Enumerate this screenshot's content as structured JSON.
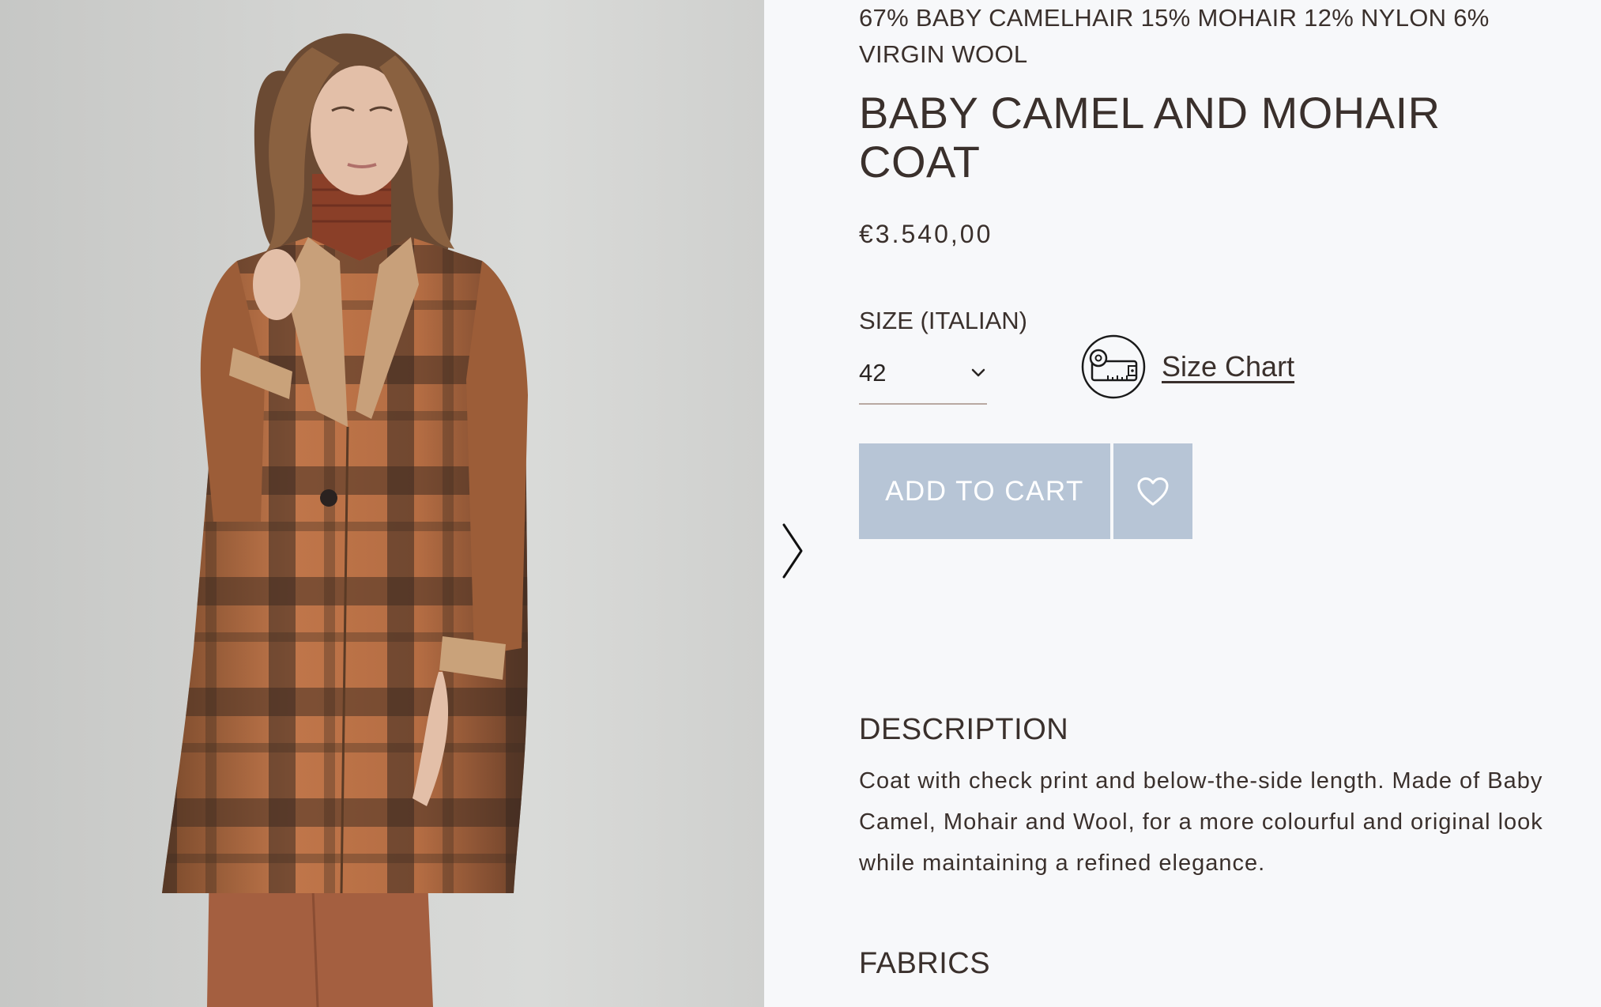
{
  "product": {
    "composition": "67% BABY CAMELHAIR 15% MOHAIR 12% NYLON 6% VIRGIN WOOL",
    "title": "BABY CAMEL AND MOHAIR COAT",
    "price": "€3.540,00"
  },
  "size": {
    "label": "SIZE (ITALIAN)",
    "selected": "42",
    "size_chart_label": "Size Chart"
  },
  "actions": {
    "add_to_cart": "ADD TO CART"
  },
  "description": {
    "heading": "DESCRIPTION",
    "body": "Coat with check print and below-the-side length. Made of Baby Camel, Mohair and Wool, for a more colourful and original look while maintaining a refined elegance."
  },
  "fabrics": {
    "heading": "FABRICS"
  },
  "icons": {
    "next": "chevron-right-icon",
    "size_select": "chevron-down-icon",
    "size_chart": "measuring-tape-icon",
    "wishlist": "heart-icon"
  },
  "colors": {
    "page_background": "#f7f8fa",
    "button_background": "#b7c5d6",
    "button_text": "#ffffff",
    "text": "#3a302c"
  }
}
